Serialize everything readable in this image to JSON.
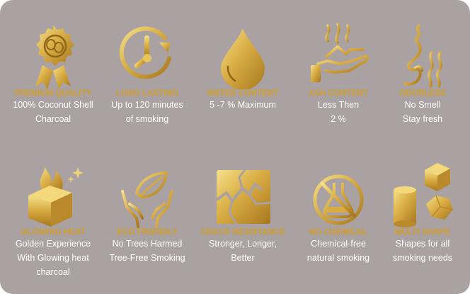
{
  "colors": {
    "card_background": "#aaa1a2",
    "gold_light": "#f4dd7e",
    "gold_dark": "#a7781f",
    "title_gold": "#d2a43a",
    "description": "#ffffff"
  },
  "features": [
    {
      "icon": "award-badge-icon",
      "title": "PREMIUM QUALITY",
      "lines": [
        "100% Coconut Shell",
        "Charcoal"
      ]
    },
    {
      "icon": "clock-icon",
      "title": "LONG LASTING",
      "lines": [
        "Up to 120 minutes",
        "of smoking"
      ]
    },
    {
      "icon": "water-drop-icon",
      "title": "WATER CONTENT",
      "lines": [
        "5 -7 % Maximum"
      ]
    },
    {
      "icon": "hand-smoke-icon",
      "title": "ASH CONTENT",
      "lines": [
        "Less Then",
        "2 %"
      ]
    },
    {
      "icon": "nose-smell-icon",
      "title": "ODORLESS",
      "lines": [
        "No Smell",
        "Stay fresh"
      ]
    },
    {
      "icon": "burning-cube-icon",
      "title": "GLOWING HEAT",
      "lines": [
        "Golden Experience",
        "With Glowing heat",
        "charcoal"
      ]
    },
    {
      "icon": "hands-leaf-icon",
      "title": "ECO FRIENDLY",
      "lines": [
        "No Trees Harmed",
        "Tree-Free Smoking"
      ]
    },
    {
      "icon": "cracked-square-icon",
      "title": "CRACK RESISTANCE",
      "lines": [
        "Stronger, Longer,",
        "Better"
      ]
    },
    {
      "icon": "no-chemical-flask-icon",
      "title": "NO CHEMICAL",
      "lines": [
        "Chemical-free",
        "natural smoking"
      ]
    },
    {
      "icon": "multi-shape-icon",
      "title": "MULTI SHAPE",
      "lines": [
        "Shapes for all",
        "smoking needs"
      ]
    }
  ]
}
